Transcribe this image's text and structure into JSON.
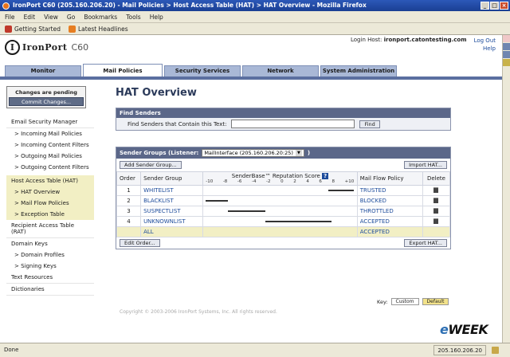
{
  "window": {
    "title": "IronPort C60 (205.160.206.20) - Mail Policies > Host Access Table (HAT) > HAT Overview - Mozilla Firefox"
  },
  "menu": [
    "File",
    "Edit",
    "View",
    "Go",
    "Bookmarks",
    "Tools",
    "Help"
  ],
  "bookmarks": [
    {
      "label": "Getting Started",
      "color": "#c0392b"
    },
    {
      "label": "Latest Headlines",
      "color": "#e67e22"
    }
  ],
  "header": {
    "logo_letter": "I",
    "brand": "IronPort",
    "model": "C60",
    "login_label": "Login Host:",
    "login_host": "ironport.catontesting.com",
    "logout": "Log Out",
    "help": "Help"
  },
  "tabs": [
    "Monitor",
    "Mail Policies",
    "Security Services",
    "Network",
    "System Administration"
  ],
  "sidebar": {
    "pending_msg": "Changes are pending",
    "commit_btn": "Commit Changes...",
    "sections": [
      {
        "title": "Email Security Manager",
        "items": [
          "Incoming Mail Policies",
          "Incoming Content Filters",
          "Outgoing Mail Policies",
          "Outgoing Content Filters"
        ]
      },
      {
        "title": "Host Access Table (HAT)",
        "items": [
          "HAT Overview",
          "Mail Flow Policies",
          "Exception Table"
        ]
      },
      {
        "title": "Recipient Access Table (RAT)",
        "items": []
      },
      {
        "title": "Domain Keys",
        "items": [
          "Domain Profiles",
          "Signing Keys"
        ]
      },
      {
        "title": "Text Resources",
        "items": []
      },
      {
        "title": "Dictionaries",
        "items": []
      }
    ]
  },
  "main": {
    "page_title": "HAT Overview",
    "find": {
      "header": "Find Senders",
      "label": "Find Senders that Contain this Text:",
      "input_value": "",
      "button": "Find"
    },
    "groups": {
      "header": "Sender Groups (Listener:",
      "listener": "MailInterface (205.160.206.20:25)",
      "header_close": ")",
      "add_btn": "Add Sender Group...",
      "import_btn": "Import HAT...",
      "edit_order_btn": "Edit Order...",
      "export_btn": "Export HAT...",
      "columns": {
        "order": "Order",
        "group": "Sender Group",
        "sbrs": "SenderBase™ Reputation Score",
        "policy": "Mail Flow Policy",
        "delete": "Delete"
      },
      "ticks": [
        "-10",
        "-8",
        "-6",
        "-4",
        "-2",
        "0",
        "2",
        "4",
        "6",
        "8",
        "+10"
      ],
      "rows": [
        {
          "order": "1",
          "name": "WHITELIST",
          "policy": "TRUSTED",
          "sbrs_from": 6.5,
          "sbrs_to": 10
        },
        {
          "order": "2",
          "name": "BLACKLIST",
          "policy": "BLOCKED",
          "sbrs_from": -10,
          "sbrs_to": -7
        },
        {
          "order": "3",
          "name": "SUSPECTLIST",
          "policy": "THROTTLED",
          "sbrs_from": -7,
          "sbrs_to": -2
        },
        {
          "order": "4",
          "name": "UNKNOWNLIST",
          "policy": "ACCEPTED",
          "sbrs_from": -2,
          "sbrs_to": 7
        },
        {
          "order": "",
          "name": "ALL",
          "policy": "ACCEPTED"
        }
      ]
    },
    "key": {
      "label": "Key:",
      "custom": "Custom",
      "default": "Default"
    },
    "copyright": "Copyright © 2003-2006 IronPort Systems, Inc. All rights reserved."
  },
  "watermark": "eWEEK",
  "status": {
    "text": "Done",
    "ip": "205.160.206.20"
  }
}
